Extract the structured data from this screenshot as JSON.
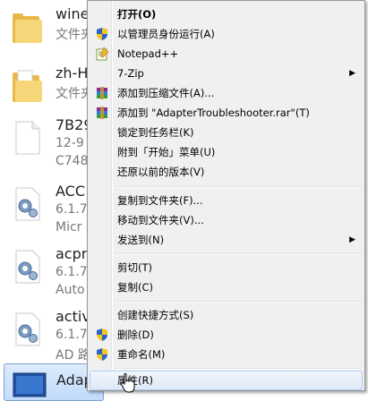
{
  "files": [
    {
      "name": "wine",
      "type": "文件夹",
      "kind": "folder-icon"
    },
    {
      "name": "zh-H",
      "type": "文件夹",
      "kind": "folder-icon"
    },
    {
      "name": "7B29",
      "type": "12-9",
      "extra": "C748",
      "kind": "blank-file-icon"
    },
    {
      "name": "ACC",
      "type": "6.1.7",
      "extra": "Micr",
      "kind": "gear-file-icon"
    },
    {
      "name": "acpr",
      "type": "6.1.7",
      "extra": "Auto",
      "kind": "gear-file-icon"
    },
    {
      "name": "activ",
      "type": "6.1.7",
      "extra": "AD 路",
      "kind": "gear-file-icon"
    },
    {
      "name": "Adap",
      "type": "",
      "extra": "",
      "kind": "screen-icon"
    }
  ],
  "menu": {
    "open": "打开(O)",
    "run_as_admin": "以管理员身份运行(A)",
    "notepadpp": "Notepad++",
    "seven_zip": "7-Zip",
    "add_to_archive": "添加到压缩文件(A)...",
    "add_to_rar": "添加到 \"AdapterTroubleshooter.rar\"(T)",
    "pin_taskbar": "锁定到任务栏(K)",
    "pin_start": "附到「开始」菜单(U)",
    "restore_versions": "还原以前的版本(V)",
    "copy_to_folder": "复制到文件夹(F)...",
    "move_to_folder": "移动到文件夹(V)...",
    "send_to": "发送到(N)",
    "cut": "剪切(T)",
    "copy": "复制(C)",
    "create_shortcut": "创建快捷方式(S)",
    "delete": "删除(D)",
    "rename": "重命名(M)",
    "properties": "属性(R)"
  },
  "colors": {
    "menu_bg": "#f0f0f0",
    "hover_border": "#aecff7",
    "folder": "#f4c95d"
  }
}
